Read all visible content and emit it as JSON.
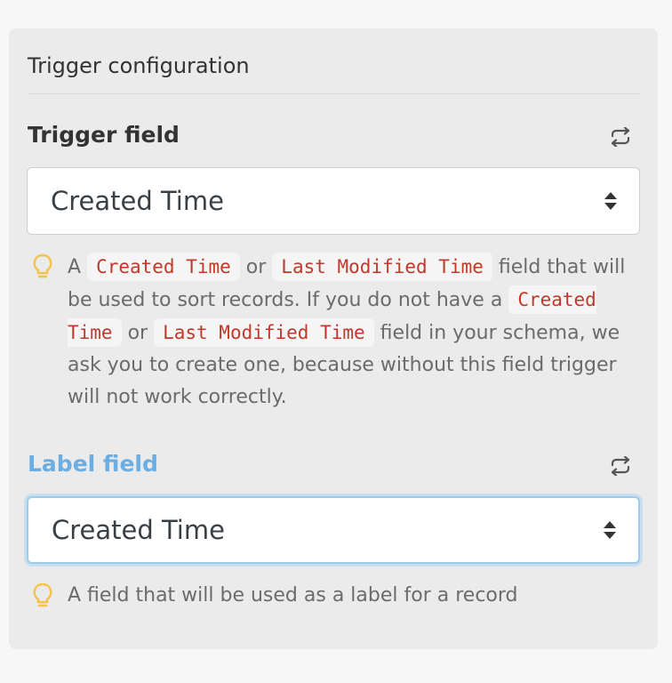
{
  "panel": {
    "header": "Trigger configuration"
  },
  "trigger_field": {
    "title": "Trigger field",
    "selected_value": "Created Time",
    "hint": {
      "prefix": "A",
      "code1": "Created Time",
      "or1": "or",
      "code2": "Last Modified Time",
      "middle": "field that will be used to sort records. If you do not have a",
      "code3": "Created Time",
      "or2": "or",
      "code4": "Last Modified Time",
      "suffix": "field in your schema, we ask you to create one, because without this field trigger will not work correctly."
    }
  },
  "label_field": {
    "title": "Label field",
    "selected_value": "Created Time",
    "hint": "A field that will be used as a label for a record"
  },
  "colors": {
    "active_label": "#6aaee3",
    "code_text": "#c0392b",
    "bulb": "#f5c24a"
  },
  "icons": {
    "refresh": "refresh-icon",
    "bulb": "lightbulb-icon",
    "select_caret": "sort-caret-icon"
  }
}
